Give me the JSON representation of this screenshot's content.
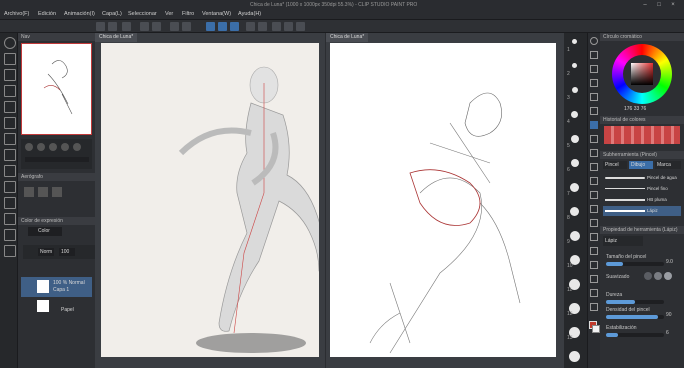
{
  "window": {
    "title": "Chica de Luna* (1000 x 1000px 350dpi 55.3%) - CLIP STUDIO PAINT PRO",
    "controls": [
      "–",
      "□",
      "×"
    ]
  },
  "menu": [
    "Archivo(F)",
    "Edición",
    "Animación(I)",
    "Capa(L)",
    "Seleccionar",
    "Ver",
    "Filtro",
    "Ventana(W)",
    "Ayuda(H)"
  ],
  "left": {
    "navigator_label": "Nav",
    "subtool_label": "Aerógrafo",
    "color_label": "Color de expresión",
    "color_value": "Color",
    "layer_mode": "Norm",
    "layer_opacity": "100",
    "layers": [
      {
        "name": "100 % Normal",
        "sub": "Capa 1"
      },
      {
        "name": "Papel",
        "sub": ""
      }
    ]
  },
  "canvas_tabs": {
    "a": "Chica de Luna*",
    "b": "Chica de Luna*"
  },
  "right_ruler": [
    "1",
    "2",
    "3",
    "4",
    "5",
    "6",
    "7",
    "8",
    "9",
    "10",
    "11",
    "12",
    "13",
    "14",
    "15",
    "16",
    "17",
    "18",
    "19",
    "20",
    "21",
    "22"
  ],
  "right": {
    "color_wheel_label": "Círculo cromático",
    "color_values": {
      "h": "176",
      "s": "33",
      "v": "76"
    },
    "history_label": "Historial de colores",
    "subtool_header": "Subherramienta (Pincel)",
    "brush_tabs": [
      "Pincel",
      "Dibujo",
      "Marca"
    ],
    "brushes": [
      "Pincel de agua",
      "Pincel fino",
      "HB pluma",
      "Lápiz"
    ],
    "props_header": "Propiedad de herramienta (Lápiz)",
    "selected_brush": "Lápiz",
    "props": [
      {
        "label": "Tamaño del pincel",
        "value": "9.0",
        "fill": 0.3
      },
      {
        "label": "Suavizado",
        "value": "",
        "fill": 0.0
      },
      {
        "label": "Dureza",
        "value": "",
        "fill": 0.5
      },
      {
        "label": "Densidad del pincel",
        "value": "90",
        "fill": 0.9
      },
      {
        "label": "Estabilización",
        "value": "6",
        "fill": 0.2
      }
    ],
    "swatch_colors": [
      "#c0392b",
      "#f2f2f2"
    ]
  },
  "colors": {
    "accent": "#5d9ad8",
    "menubar": "#2a2c30",
    "panel": "#2d2f33"
  }
}
